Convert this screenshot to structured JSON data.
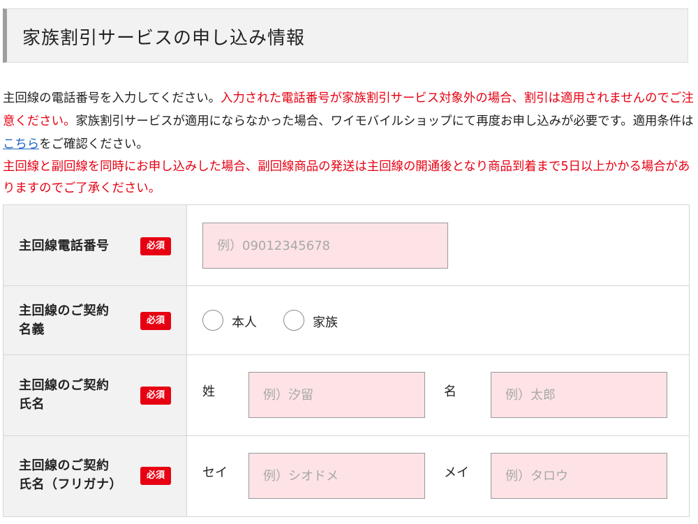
{
  "section": {
    "title": "家族割引サービスの申し込み情報"
  },
  "notice": {
    "part1": "主回線の電話番号を入力してください。",
    "part2_red": "入力された電話番号が家族割引サービス対象外の場合、割引は適用されませんのでご注意ください。",
    "part3": "家族割引サービスが適用にならなかった場合、ワイモバイルショップにて再度お申し込みが必要です。適用条件は",
    "link": "こちら",
    "part4": "をご確認ください。",
    "part5_red": "主回線と副回線を同時にお申し込みした場合、副回線商品の発送は主回線の開通後となり商品到着まで5日以上かかる場合がありますのでご了承ください。"
  },
  "required_label": "必須",
  "rows": {
    "phone": {
      "label": "主回線電話番号",
      "placeholder": "例）09012345678"
    },
    "holder": {
      "label_line1": "主回線のご契約",
      "label_line2": "名義",
      "option1": "本人",
      "option2": "家族"
    },
    "name": {
      "label_line1": "主回線のご契約",
      "label_line2": "氏名",
      "sei": "姓",
      "mei": "名",
      "sei_placeholder": "例）汐留",
      "mei_placeholder": "例）太郎"
    },
    "kana": {
      "label_line1": "主回線のご契約",
      "label_line2": "氏名（フリガナ）",
      "sei": "セイ",
      "mei": "メイ",
      "sei_placeholder": "例）シオドメ",
      "mei_placeholder": "例）タロウ"
    }
  }
}
